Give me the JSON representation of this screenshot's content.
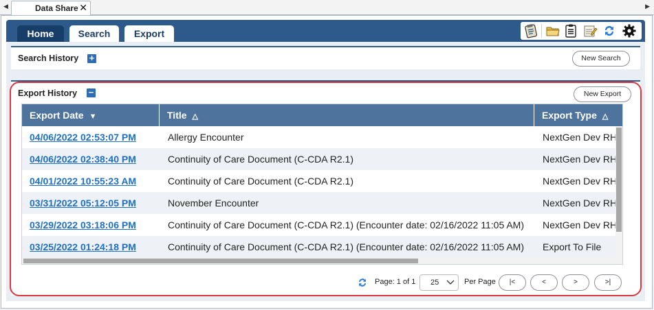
{
  "doc_tab": {
    "label": "Data Share",
    "close": "✕",
    "scroll_left": "◀",
    "scroll_right": "▶"
  },
  "nav": {
    "home": "Home",
    "search": "Search",
    "export": "Export"
  },
  "toolbar": {
    "icons": [
      "clipboard-report-icon",
      "folder-open-icon",
      "clipboard-list-icon",
      "edit-note-icon",
      "sync-icon",
      "gear-icon"
    ]
  },
  "search_history": {
    "title": "Search History",
    "toggle": "+",
    "new_button": "New Search"
  },
  "export_history": {
    "title": "Export History",
    "toggle": "−",
    "new_button": "New Export",
    "columns": [
      {
        "label": "Export Date",
        "sort": "▼"
      },
      {
        "label": "Title",
        "sort": "△"
      },
      {
        "label": "Export Type",
        "sort": "△"
      }
    ],
    "rows": [
      {
        "date": "04/06/2022 02:53:07 PM",
        "title": "Allergy Encounter",
        "type": "NextGen Dev RHIO"
      },
      {
        "date": "04/06/2022 02:38:40 PM",
        "title": "Continuity of Care Document (C-CDA R2.1)",
        "type": "NextGen Dev RHIO"
      },
      {
        "date": "04/01/2022 10:55:23 AM",
        "title": "Continuity of Care Document (C-CDA R2.1)",
        "type": "NextGen Dev RHIO"
      },
      {
        "date": "03/31/2022 05:12:05 PM",
        "title": "November Encounter",
        "type": "NextGen Dev RHIO"
      },
      {
        "date": "03/29/2022 03:18:06 PM",
        "title": "Continuity of Care Document (C-CDA R2.1) (Encounter date: 02/16/2022 11:05 AM)",
        "type": "NextGen Dev RHIO"
      },
      {
        "date": "03/25/2022 01:24:18 PM",
        "title": "Continuity of Care Document (C-CDA R2.1) (Encounter date: 02/16/2022 11:05 AM)",
        "type": "Export To File"
      }
    ]
  },
  "pager": {
    "page_info": "Page: 1 of 1",
    "page_size": "25",
    "per_page": "Per Page",
    "first": "|<",
    "prev": "<",
    "next": ">",
    "last": ">|"
  },
  "colors": {
    "header_blue": "#2d5a8a",
    "grid_header": "#4e739c",
    "link": "#1e6fc8",
    "highlight": "#d9363e"
  }
}
